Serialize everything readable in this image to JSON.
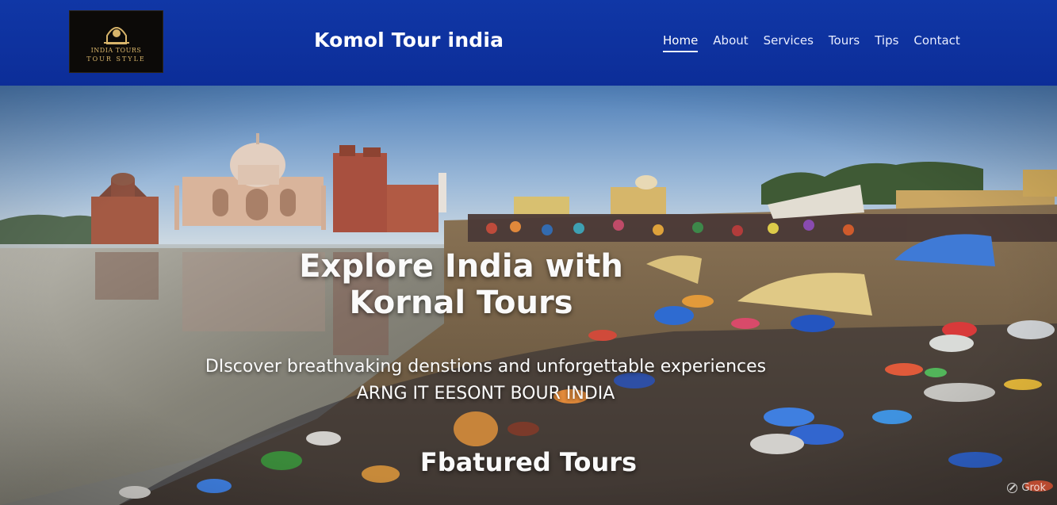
{
  "header": {
    "logo_line1": "INDIA TOURS",
    "logo_line2": "TOUR STYLE",
    "brand": "Komol Tour india",
    "nav": [
      {
        "label": "Home",
        "active": true
      },
      {
        "label": "About"
      },
      {
        "label": "Services"
      },
      {
        "label": "Tours"
      },
      {
        "label": "Tips"
      },
      {
        "label": "Contact"
      }
    ]
  },
  "hero": {
    "title_line1": "Explore India with",
    "title_line2": "Kornal Tours",
    "subtitle_line1": "DIscover breathvaking denstions and unforgettable experiences",
    "subtitle_line2": "ARNG  IT  EESONT BOUR INDIA"
  },
  "featured": {
    "title": "Fbatured Tours"
  },
  "watermark": {
    "icon": "grok-icon",
    "label": "Grok"
  },
  "colors": {
    "navbar": "#0c2d98",
    "nav_text": "#e8edff",
    "hero_text": "#fafafa"
  }
}
